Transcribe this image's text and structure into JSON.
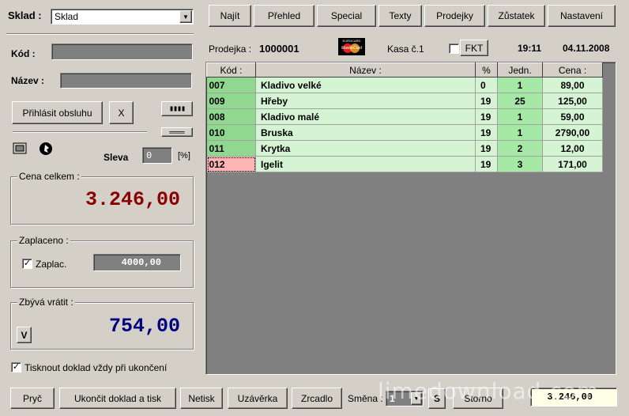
{
  "sklad": {
    "label": "Sklad :",
    "value": "Sklad"
  },
  "toolbar": [
    "Najít",
    "Přehled",
    "Special",
    "Texty",
    "Prodejky",
    "Zůstatek",
    "Nastavení"
  ],
  "left": {
    "kod_label": "Kód :",
    "nazev_label": "Název :",
    "login_button": "Přihlásit obsluhu",
    "x_button": "X",
    "sleva_label": "Sleva",
    "sleva_value": "0",
    "sleva_unit": "[%]",
    "cena_celkem": {
      "title": "Cena celkem :",
      "value": "3.246,00"
    },
    "zaplaceno": {
      "title": "Zaplaceno :",
      "check_label": "Zaplac.",
      "value": "4000,00"
    },
    "zbyva": {
      "title": "Zbývá vrátit :",
      "button": "V",
      "value": "754,00"
    },
    "tisknout_label": "Tisknout doklad vždy při ukončení"
  },
  "header": {
    "prodejka_label": "Prodejka :",
    "prodejka_value": "1000001",
    "card_top": "EUROCARD",
    "card_name": "MasterCard",
    "kasa": "Kasa č.1",
    "fkt": "FKT",
    "time": "19:11",
    "date": "04.11.2008"
  },
  "table": {
    "headers": [
      "Kód :",
      "Název :",
      "%",
      "Jedn.",
      "Cena :"
    ],
    "rows": [
      [
        "007",
        "Kladivo velké",
        "0",
        "1",
        "89,00"
      ],
      [
        "009",
        "Hřeby",
        "19",
        "25",
        "125,00"
      ],
      [
        "008",
        "Kladivo malé",
        "19",
        "1",
        "59,00"
      ],
      [
        "010",
        "Bruska",
        "19",
        "1",
        "2790,00"
      ],
      [
        "011",
        "Krytka",
        "19",
        "2",
        "12,00"
      ],
      [
        "012",
        "Igelit",
        "19",
        "3",
        "171,00"
      ]
    ]
  },
  "bottom": {
    "pryc": "Pryč",
    "ukoncit": "Ukončit doklad a tisk",
    "netisk": "Netisk",
    "uzaverka": "Uzávěrka",
    "zrcadlo": "Zrcadlo",
    "smena_label": "Směna :",
    "smena_value": "1",
    "s_button": "S",
    "storno": "Storno",
    "total": "3.246,00"
  },
  "watermark": "limedownload.com",
  "colors": {
    "total_red": "#8b0000",
    "remaining_blue": "#000080",
    "row_green": "#d4f4d4",
    "code_green": "#90d890",
    "selected_pink": "#ffb4b4"
  }
}
